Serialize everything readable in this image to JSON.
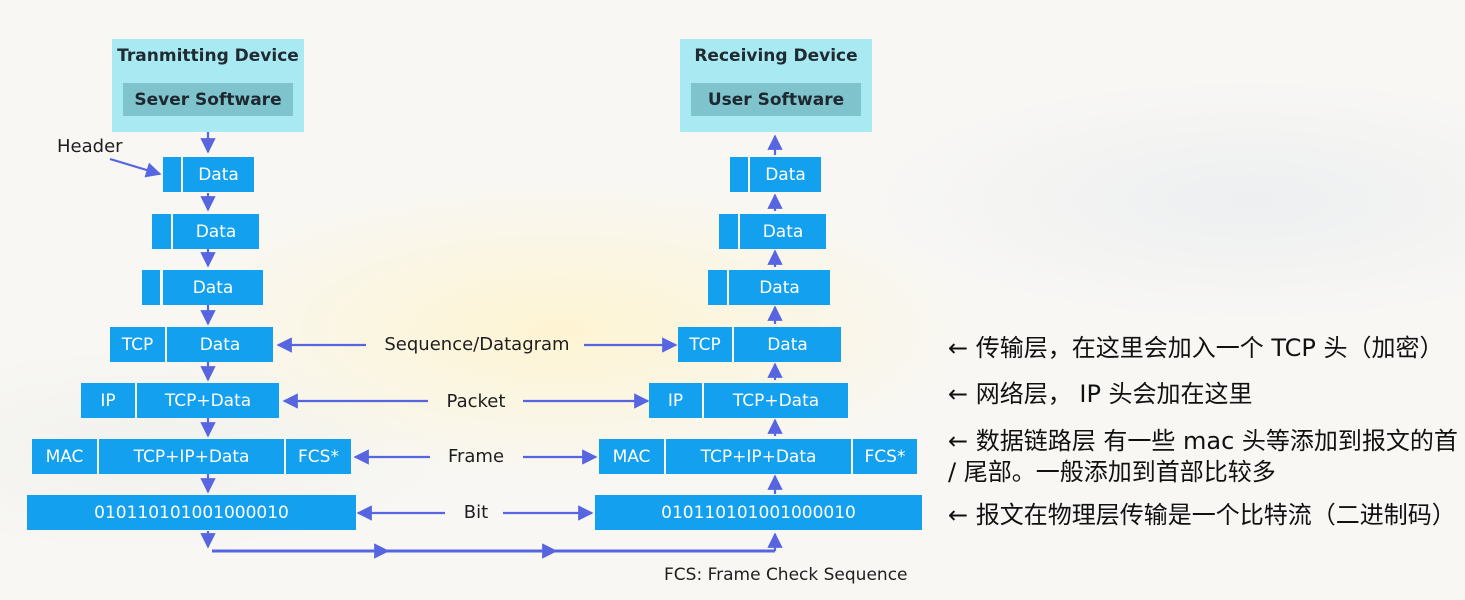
{
  "transmit": {
    "title": "Tranmitting Device",
    "software": "Sever Software"
  },
  "receive": {
    "title": "Receiving Device",
    "software": "User Software"
  },
  "header_label": "Header",
  "data_label": "Data",
  "tcp_label": "TCP",
  "ip_label": "IP",
  "mac_label": "MAC",
  "tcp_data_label": "TCP+Data",
  "tcp_ip_data_label": "TCP+IP+Data",
  "fcs_label": "FCS*",
  "bits_label": "010110101001000010",
  "middle": {
    "sequence": "Sequence/Datagram",
    "packet": "Packet",
    "frame": "Frame",
    "bit": "Bit"
  },
  "footnote": "FCS: Frame Check Sequence",
  "notes": {
    "transport": "← 传输层，在这里会加入一个 TCP 头（加密）",
    "network": "← 网络层， IP 头会加在这里",
    "datalink": "← 数据链路层 有一些 mac 头等添加到报文的首 / 尾部。一般添加到首部比较多",
    "physical": "← 报文在物理层传输是一个比特流（二进制码）"
  },
  "colors": {
    "block": "#13a0ee",
    "device": "#a9e9f1",
    "device_inner": "#7fc3cd",
    "arrow": "#5766e0"
  }
}
